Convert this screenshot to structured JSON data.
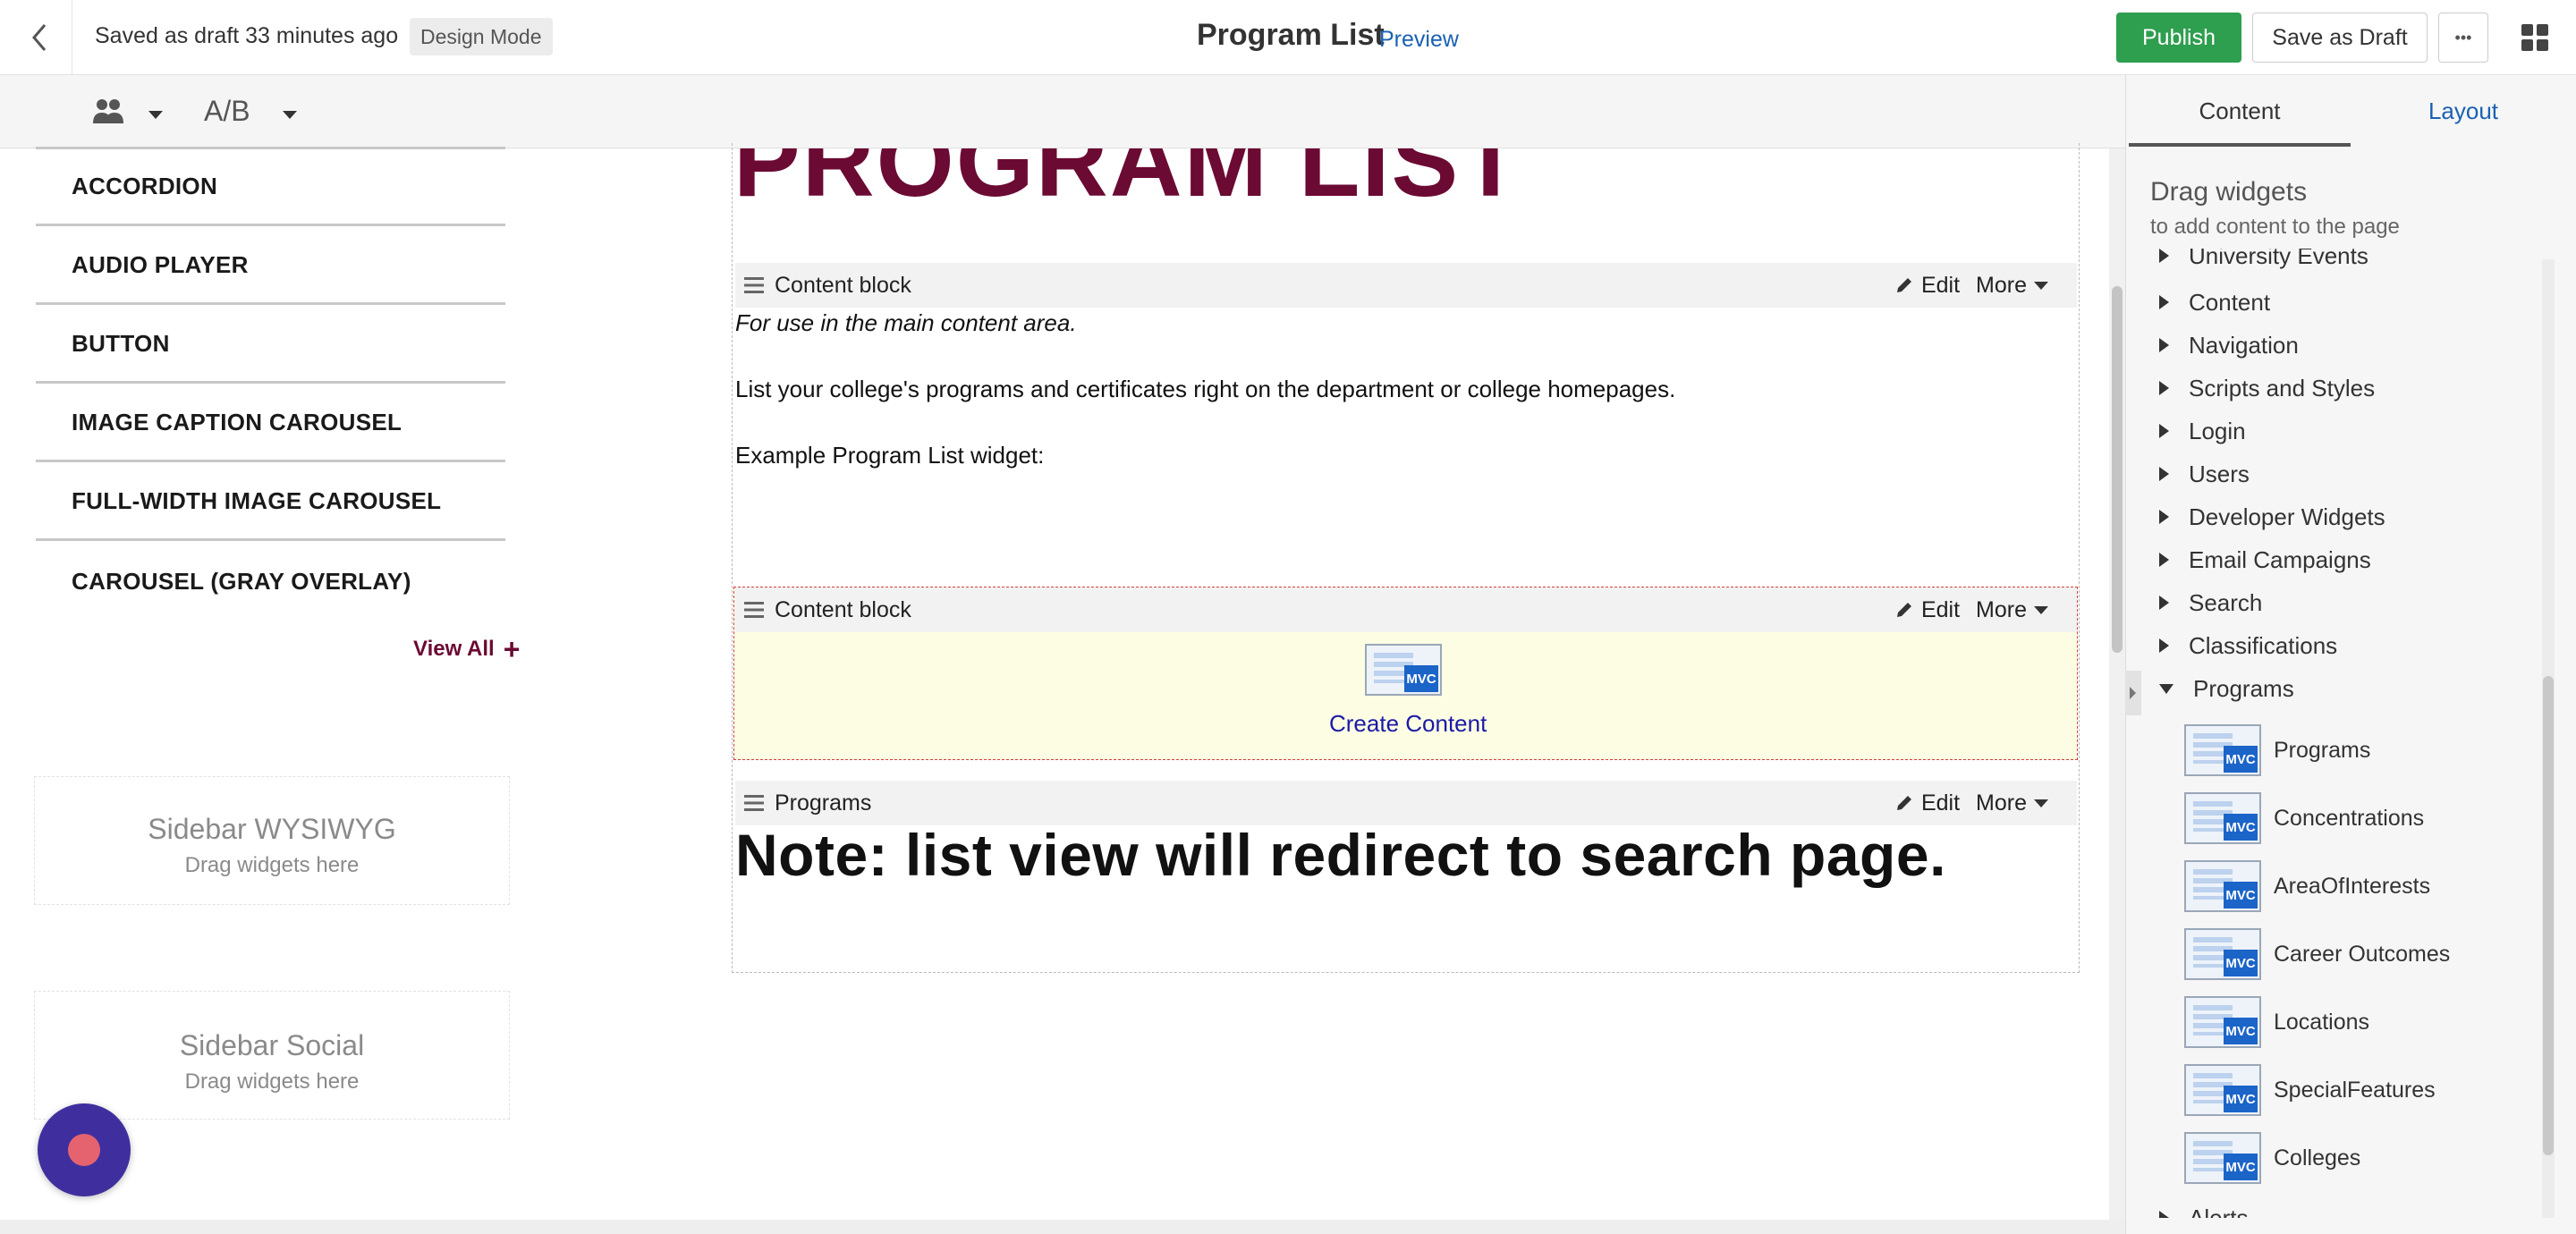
{
  "topbar": {
    "draft_status": "Saved as draft 33 minutes ago",
    "mode_badge": "Design Mode",
    "page_title": "Program List",
    "preview_link": "Preview",
    "publish_label": "Publish",
    "save_draft_label": "Save as Draft",
    "more_label": "•••"
  },
  "toolbar": {
    "ab_label": "A/B"
  },
  "left_nav": {
    "items": [
      "ACCORDION",
      "AUDIO PLAYER",
      "BUTTON",
      "IMAGE CAPTION CAROUSEL",
      "FULL-WIDTH IMAGE CAROUSEL",
      "CAROUSEL (GRAY OVERLAY)"
    ],
    "view_all": "View All"
  },
  "sidebar_zones": [
    {
      "title": "Sidebar WYSIWYG",
      "hint": "Drag widgets here"
    },
    {
      "title": "Sidebar Social",
      "hint": "Drag widgets here"
    }
  ],
  "canvas": {
    "heading": "PROGRAM LIST",
    "blocks": [
      {
        "name": "Content block",
        "edit": "Edit",
        "more": "More"
      },
      {
        "name": "Content block",
        "edit": "Edit",
        "more": "More"
      },
      {
        "name": "Programs",
        "edit": "Edit",
        "more": "More"
      }
    ],
    "para1": "For use in the main content area.",
    "para2": "List your college's programs and certificates right on the department or college homepages.",
    "para3": "Example Program List widget:",
    "create_content": "Create Content",
    "mvc_badge": "MVC",
    "note": "Note: list view will redirect to search page."
  },
  "right_panel": {
    "tabs": [
      "Content",
      "Layout"
    ],
    "heading": "Drag widgets",
    "subheading": "to add content to the page",
    "tree": [
      "University Events",
      "Content",
      "Navigation",
      "Scripts and Styles",
      "Login",
      "Users",
      "Developer Widgets",
      "Email Campaigns",
      "Search",
      "Classifications",
      "Programs"
    ],
    "program_widgets": [
      "Programs",
      "Concentrations",
      "AreaOfInterests",
      "Career Outcomes",
      "Locations",
      "SpecialFeatures",
      "Colleges"
    ],
    "tree_tail": "Alerts"
  },
  "colors": {
    "publish_green": "#2e9e4f",
    "heading_maroon": "#6b0a33",
    "link_blue": "#1a61b3",
    "placeholder_yellow": "#fdfde3",
    "chat_button_purple": "#3f2f9e",
    "chat_button_dot": "#e5636f"
  }
}
